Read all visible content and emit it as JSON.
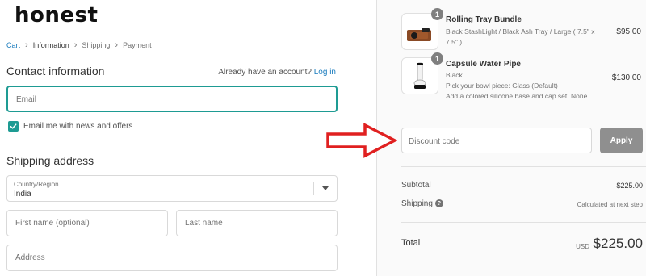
{
  "brand": {
    "logo_text": "honest"
  },
  "breadcrumb": [
    {
      "label": "Cart",
      "state": "link"
    },
    {
      "label": "Information",
      "state": "current"
    },
    {
      "label": "Shipping",
      "state": "upcoming"
    },
    {
      "label": "Payment",
      "state": "upcoming"
    }
  ],
  "contact": {
    "title": "Contact information",
    "account_prompt": "Already have an account?",
    "login_label": "Log in",
    "email_placeholder": "Email",
    "newsletter_label": "Email me with news and offers",
    "newsletter_checked": true
  },
  "shipping": {
    "title": "Shipping address",
    "country_label": "Country/Region",
    "country_value": "India",
    "first_name_placeholder": "First name (optional)",
    "last_name_placeholder": "Last name",
    "address_placeholder": "Address"
  },
  "cart": {
    "items": [
      {
        "quantity": "1",
        "name": "Rolling Tray Bundle",
        "variant_line1": "Black StashLight / Black Ash Tray / Large ( 7.5\" x",
        "variant_line2": "7.5\" )",
        "price": "$95.00"
      },
      {
        "quantity": "1",
        "name": "Capsule Water Pipe",
        "variant_line1": "Black",
        "option_line1": "Pick your bowl piece: Glass (Default)",
        "option_line2": "Add a colored silicone base and cap set: None",
        "price": "$130.00"
      }
    ]
  },
  "discount": {
    "placeholder": "Discount code",
    "apply_label": "Apply"
  },
  "summary": {
    "subtotal_label": "Subtotal",
    "subtotal_value": "$225.00",
    "shipping_label": "Shipping",
    "shipping_help_icon": "?",
    "shipping_value": "Calculated at next step",
    "total_label": "Total",
    "currency": "USD",
    "total_value": "$225.00"
  },
  "colors": {
    "accent": "#1e9b93",
    "link": "#197bbd",
    "apply_button": "#8f8f8f",
    "annotation_arrow": "#e02020"
  }
}
